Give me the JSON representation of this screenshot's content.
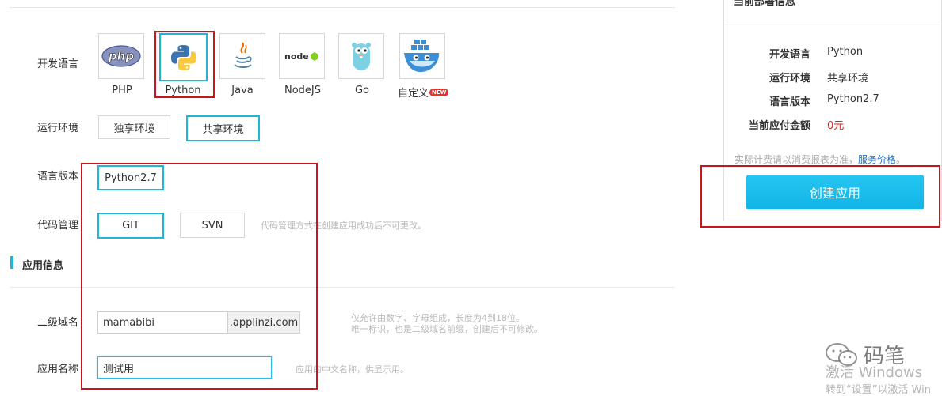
{
  "form": {
    "dev_lang_label": "开发语言",
    "languages": [
      {
        "name": "PHP",
        "icon": "php-logo-icon",
        "selected": false
      },
      {
        "name": "Python",
        "icon": "python-logo-icon",
        "selected": true
      },
      {
        "name": "Java",
        "icon": "java-logo-icon",
        "selected": false
      },
      {
        "name": "NodeJS",
        "icon": "nodejs-logo-icon",
        "selected": false
      },
      {
        "name": "Go",
        "icon": "go-gopher-icon",
        "selected": false
      },
      {
        "name": "自定义",
        "icon": "docker-whale-icon",
        "selected": false,
        "badge": "NEW"
      }
    ],
    "runtime_label": "运行环境",
    "runtime_options": [
      "独享环境",
      "共享环境"
    ],
    "runtime_selected": "共享环境",
    "version_label": "语言版本",
    "version_value": "Python2.7",
    "code_label": "代码管理",
    "code_options": [
      "GIT",
      "SVN"
    ],
    "code_selected": "GIT",
    "code_hint": "代码管理方式在创建应用成功后不可更改。",
    "app_section_title": "应用信息",
    "subdomain_label": "二级域名",
    "subdomain_value": "mamabibi",
    "subdomain_suffix": ".applinzi.com",
    "subdomain_hint_1": "仅允许由数字、字母组成，长度为4到18位。",
    "subdomain_hint_2": "唯一标识，也是二级域名前缀，创建后不可修改。",
    "appname_label": "应用名称",
    "appname_value": "测试用",
    "appname_hint": "应用的中文名称，供显示用。"
  },
  "summary": {
    "title": "当前部署信息",
    "rows": [
      {
        "label": "开发语言",
        "value": "Python"
      },
      {
        "label": "运行环境",
        "value": "共享环境"
      },
      {
        "label": "语言版本",
        "value": "Python2.7"
      },
      {
        "label": "当前应付金额",
        "value": "0元"
      }
    ],
    "note": "实际计费请以消费报表为准，",
    "price_link": "服务价格",
    "note_end": "。",
    "create_button": "创建应用"
  },
  "watermark": {
    "brand": "码笔",
    "activate_title": "激活 Windows",
    "activate_sub": "转到“设置”以激活 Win"
  },
  "colors": {
    "accent": "#1fb6d8",
    "annotation_red": "#c8161d",
    "price_red": "#e02020",
    "link_blue": "#1a6fc9"
  }
}
